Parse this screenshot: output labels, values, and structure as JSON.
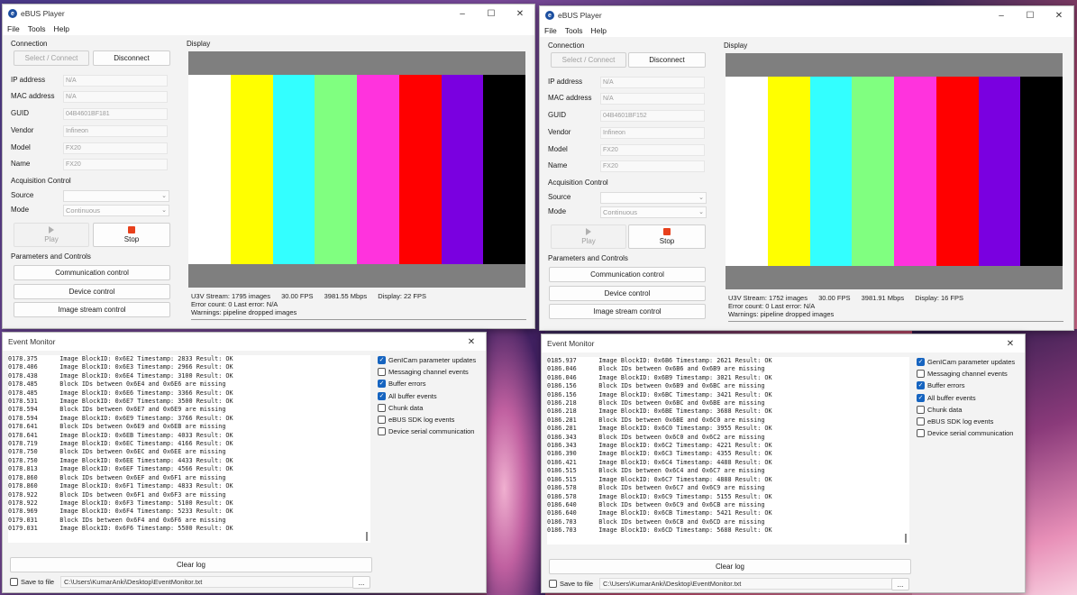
{
  "app": {
    "title": "eBUS Player",
    "menu": [
      "File",
      "Tools",
      "Help"
    ]
  },
  "labels": {
    "connection": "Connection",
    "select_connect": "Select / Connect",
    "disconnect": "Disconnect",
    "ip": "IP address",
    "mac": "MAC address",
    "guid": "GUID",
    "vendor": "Vendor",
    "model": "Model",
    "name": "Name",
    "acq": "Acquisition Control",
    "source": "Source",
    "mode": "Mode",
    "play": "Play",
    "stop": "Stop",
    "params": "Parameters and Controls",
    "comm": "Communication control",
    "device": "Device control",
    "stream": "Image stream control",
    "display": "Display"
  },
  "players": [
    {
      "ip": "N/A",
      "mac": "N/A",
      "guid": "04B4601BF181",
      "vendor": "Infineon",
      "model": "FX20",
      "name": "FX20",
      "source": "",
      "mode": "Continuous",
      "stream": "U3V Stream: 1795 images",
      "fps": "30.00 FPS",
      "mbps": "3981.55 Mbps",
      "disp_fps": "Display: 22 FPS",
      "errors": "Error count: 0    Last error: N/A",
      "warnings": "Warnings: pipeline dropped images"
    },
    {
      "ip": "N/A",
      "mac": "N/A",
      "guid": "04B4601BF152",
      "vendor": "Infineon",
      "model": "FX20",
      "name": "FX20",
      "source": "",
      "mode": "Continuous",
      "stream": "U3V Stream: 1752 images",
      "fps": "30.00 FPS",
      "mbps": "3981.91 Mbps",
      "disp_fps": "Display: 16 FPS",
      "errors": "Error count: 0    Last error: N/A",
      "warnings": "Warnings: pipeline dropped images"
    }
  ],
  "colors": {
    "bars": [
      "#ffffff",
      "#ffff00",
      "#33ffff",
      "#80ff80",
      "#ff33dd",
      "#ff0000",
      "#7a00e0",
      "#000000"
    ],
    "bar_bg": "#7f7f7f",
    "checkbox_on": "#1664c0",
    "stop": "#e8401c"
  },
  "monitor": {
    "title": "Event Monitor",
    "clear_log": "Clear log",
    "save_to_file": "Save to file",
    "path": "C:\\Users\\KumarAnki\\Desktop\\EventMonitor.txt",
    "browse": "...",
    "options": [
      {
        "label": "GenICam parameter updates",
        "checked": true
      },
      {
        "label": "Messaging channel events",
        "checked": false
      },
      {
        "label": "Buffer errors",
        "checked": true
      },
      {
        "label": "All buffer events",
        "checked": true
      },
      {
        "label": "Chunk data",
        "checked": false
      },
      {
        "label": "eBUS SDK log events",
        "checked": false
      },
      {
        "label": "Device serial communication",
        "checked": false
      }
    ]
  },
  "logs": [
    [
      "0178.375      Image BlockID: 0x6E2 Timestamp: 2833 Result: OK",
      "0178.406      Image BlockID: 0x6E3 Timestamp: 2966 Result: OK",
      "0178.438      Image BlockID: 0x6E4 Timestamp: 3100 Result: OK",
      "0178.485      Block IDs between 0x6E4 and 0x6E6 are missing",
      "0178.485      Image BlockID: 0x6E6 Timestamp: 3366 Result: OK",
      "0178.531      Image BlockID: 0x6E7 Timestamp: 3500 Result: OK",
      "0178.594      Block IDs between 0x6E7 and 0x6E9 are missing",
      "0178.594      Image BlockID: 0x6E9 Timestamp: 3766 Result: OK",
      "0178.641      Block IDs between 0x6E9 and 0x6EB are missing",
      "0178.641      Image BlockID: 0x6EB Timestamp: 4033 Result: OK",
      "0178.719      Image BlockID: 0x6EC Timestamp: 4166 Result: OK",
      "0178.750      Block IDs between 0x6EC and 0x6EE are missing",
      "0178.750      Image BlockID: 0x6EE Timestamp: 4433 Result: OK",
      "0178.813      Image BlockID: 0x6EF Timestamp: 4566 Result: OK",
      "0178.860      Block IDs between 0x6EF and 0x6F1 are missing",
      "0178.860      Image BlockID: 0x6F1 Timestamp: 4833 Result: OK",
      "0178.922      Block IDs between 0x6F1 and 0x6F3 are missing",
      "0178.922      Image BlockID: 0x6F3 Timestamp: 5100 Result: OK",
      "0178.969      Image BlockID: 0x6F4 Timestamp: 5233 Result: OK",
      "0179.031      Block IDs between 0x6F4 and 0x6F6 are missing",
      "0179.031      Image BlockID: 0x6F6 Timestamp: 5500 Result: OK"
    ],
    [
      "0185.937      Image BlockID: 0x6B6 Timestamp: 2621 Result: OK",
      "0186.046      Block IDs between 0x6B6 and 0x6B9 are missing",
      "0186.046      Image BlockID: 0x6B9 Timestamp: 3021 Result: OK",
      "0186.156      Block IDs between 0x6B9 and 0x6BC are missing",
      "0186.156      Image BlockID: 0x6BC Timestamp: 3421 Result: OK",
      "0186.218      Block IDs between 0x6BC and 0x6BE are missing",
      "0186.218      Image BlockID: 0x6BE Timestamp: 3688 Result: OK",
      "0186.281      Block IDs between 0x6BE and 0x6C0 are missing",
      "0186.281      Image BlockID: 0x6C0 Timestamp: 3955 Result: OK",
      "0186.343      Block IDs between 0x6C0 and 0x6C2 are missing",
      "0186.343      Image BlockID: 0x6C2 Timestamp: 4221 Result: OK",
      "0186.390      Image BlockID: 0x6C3 Timestamp: 4355 Result: OK",
      "0186.421      Image BlockID: 0x6C4 Timestamp: 4488 Result: OK",
      "0186.515      Block IDs between 0x6C4 and 0x6C7 are missing",
      "0186.515      Image BlockID: 0x6C7 Timestamp: 4888 Result: OK",
      "0186.578      Block IDs between 0x6C7 and 0x6C9 are missing",
      "0186.578      Image BlockID: 0x6C9 Timestamp: 5155 Result: OK",
      "0186.640      Block IDs between 0x6C9 and 0x6CB are missing",
      "0186.640      Image BlockID: 0x6CB Timestamp: 5421 Result: OK",
      "0186.703      Block IDs between 0x6CB and 0x6CD are missing",
      "0186.703      Image BlockID: 0x6CD Timestamp: 5688 Result: OK"
    ]
  ]
}
